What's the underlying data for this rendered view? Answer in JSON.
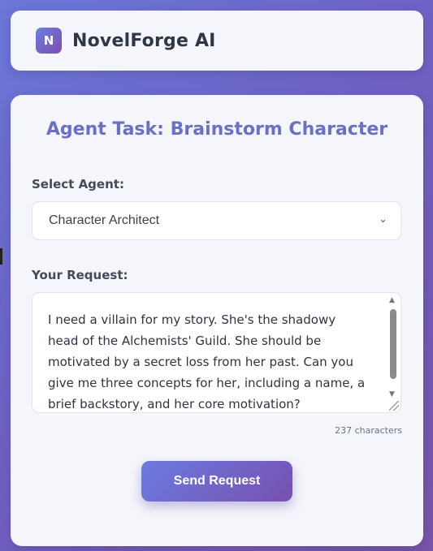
{
  "header": {
    "logo_letter": "N",
    "app_name": "NovelForge AI"
  },
  "task": {
    "title": "Agent Task: Brainstorm Character"
  },
  "agent_select": {
    "label": "Select Agent:",
    "selected": "Character Architect",
    "chevron_icon": "chevron-down-icon"
  },
  "request": {
    "label": "Your Request:",
    "value": "I need a villain for my story. She's the shadowy head of the Alchemists' Guild. She should be motivated by a secret loss from her past. Can you give me three concepts for her, including a name, a brief backstory, and her core motivation?",
    "char_count": "237 characters"
  },
  "actions": {
    "send_label": "Send Request"
  },
  "colors": {
    "accent": "#6a6fc8",
    "gradient_start": "#6b7be0",
    "gradient_end": "#7750b0"
  }
}
